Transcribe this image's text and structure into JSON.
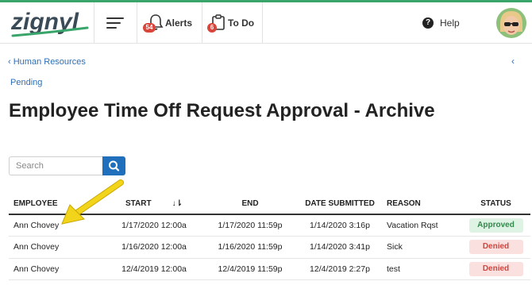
{
  "header": {
    "logo_text": "zignyl",
    "alerts": {
      "label": "Alerts",
      "count": "54"
    },
    "todo": {
      "label": "To Do",
      "count": "6"
    },
    "help_label": "Help"
  },
  "breadcrumb": {
    "parent": "Human Resources",
    "current": "Pending"
  },
  "page": {
    "title_main": "Employee Time Off Request Approval - ",
    "title_bold": "Archive"
  },
  "search": {
    "placeholder": "Search"
  },
  "table": {
    "columns": [
      "EMPLOYEE",
      "START",
      "END",
      "DATE SUBMITTED",
      "REASON",
      "STATUS"
    ],
    "rows": [
      {
        "employee": "Ann Chovey",
        "start": "1/17/2020 12:00a",
        "end": "1/17/2020 11:59p",
        "submitted": "1/14/2020 3:16p",
        "reason": "Vacation Rqst",
        "status": "Approved"
      },
      {
        "employee": "Ann Chovey",
        "start": "1/16/2020 12:00a",
        "end": "1/16/2020 11:59p",
        "submitted": "1/14/2020 3:41p",
        "reason": "Sick",
        "status": "Denied"
      },
      {
        "employee": "Ann Chovey",
        "start": "12/4/2019 12:00a",
        "end": "12/4/2019 11:59p",
        "submitted": "12/4/2019 2:27p",
        "reason": "test",
        "status": "Denied"
      }
    ]
  },
  "colors": {
    "brand_green": "#3aa56b",
    "link_blue": "#2d6fb8",
    "button_blue": "#1f6fbd",
    "badge_red": "#d9453b",
    "approved_text": "#2f8a4a",
    "denied_text": "#d0463e",
    "arrow_yellow": "#f2d51b"
  },
  "icons": [
    "hamburger-icon",
    "bell-icon",
    "clipboard-icon",
    "help-icon",
    "search-icon",
    "chevron-left-icon",
    "sort-icon"
  ]
}
